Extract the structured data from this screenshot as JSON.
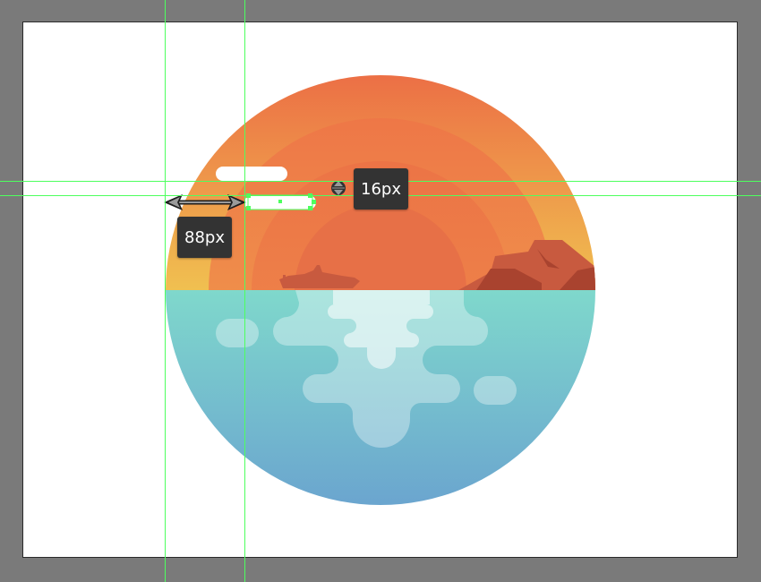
{
  "measurements": {
    "horizontal_distance_label": "88px",
    "vertical_distance_label": "16px"
  },
  "colors": {
    "canvas_bg": "#7a7a7a",
    "artboard_bg": "#ffffff",
    "guide": "#4dff5e",
    "sky_top": "#ec6e45",
    "sky_bottom": "#f0c050",
    "sun": "#e77047",
    "rocks": "#c85a3f",
    "rocks_dark": "#a9432f",
    "water_top": "#7fd8cc",
    "water_bottom": "#6aa3cf",
    "tooltip_bg": "#333333",
    "tooltip_text": "#ffffff"
  },
  "icons": [
    "ship-icon",
    "double-arrow-icon",
    "vertical-resize-icon"
  ]
}
